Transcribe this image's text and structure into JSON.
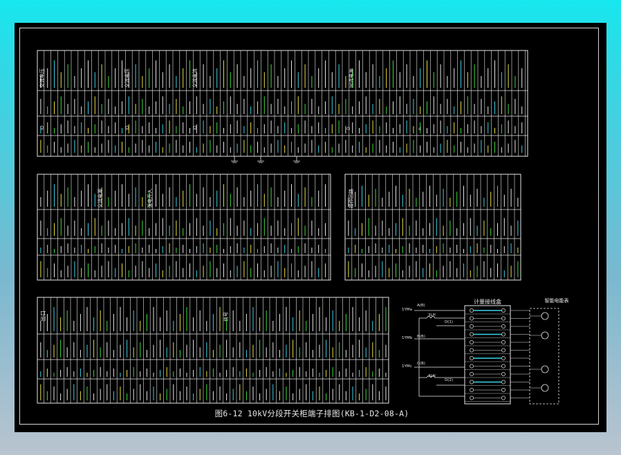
{
  "caption": "图6-12 10kV分段开关柜端子排图(KB-1-D2-08-A)",
  "tables": {
    "top": {
      "headers": [
        "交流电压",
        "交流电压",
        "交流电流",
        "回流电源"
      ],
      "col_labels": [
        "ID",
        "ID",
        "ID",
        "D",
        "n"
      ]
    },
    "mid_left": {
      "headers": [
        "交流电源",
        "强电开入"
      ]
    },
    "mid_right": {
      "headers": [
        "操作回路"
      ]
    },
    "bottom": {
      "headers": [
        "出口",
        "信号"
      ]
    }
  },
  "meter_box": {
    "title": "计量接线盒",
    "right_title": "智能电能表",
    "labels": [
      "1YMa",
      "1YMb",
      "1YMc",
      "A(B)",
      "B(B)",
      "C(B)",
      "D(1)",
      "D(2)",
      "3LH",
      "3LH"
    ]
  },
  "colors": {
    "sheet": "#000000",
    "line": "#e8e8e8",
    "accent_green": "#3fdc3f",
    "accent_cyan": "#3fd2e8",
    "accent_yellow": "#e8e23f",
    "accent_red": "#ff3f3f"
  }
}
